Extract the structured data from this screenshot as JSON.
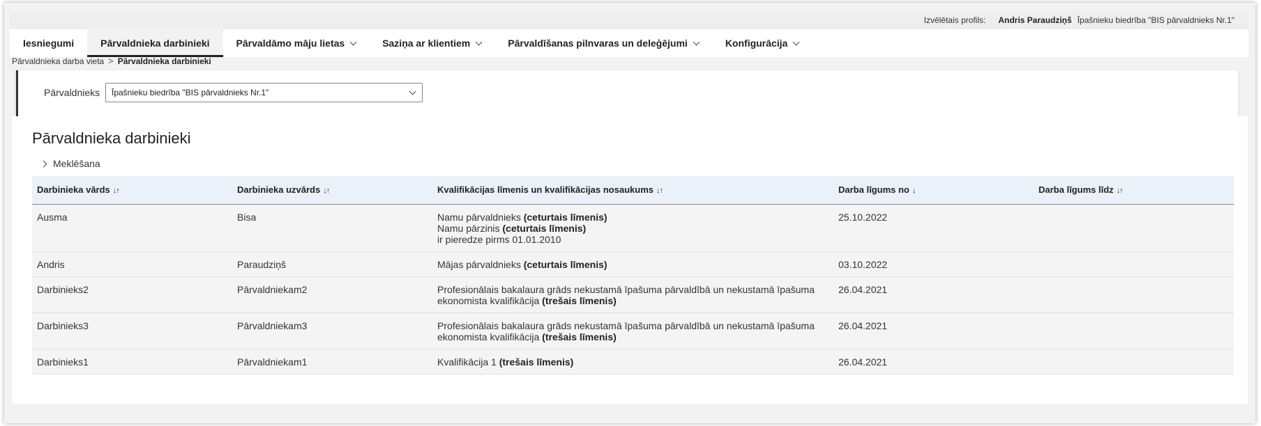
{
  "topbar": {
    "profile_label": "Izvēlētais profils:",
    "user_name": "Andris Paraudziņš",
    "organization": "Īpašnieku biedrība \"BIS pārvaldnieks Nr.1\""
  },
  "nav": {
    "items": [
      {
        "label": "Iesniegumi",
        "active": false,
        "dropdown": false
      },
      {
        "label": "Pārvaldnieka darbinieki",
        "active": true,
        "dropdown": false
      },
      {
        "label": "Pārvaldāmo māju lietas",
        "active": false,
        "dropdown": true
      },
      {
        "label": "Saziņa ar klientiem",
        "active": false,
        "dropdown": true
      },
      {
        "label": "Pārvaldīšanas pilnvaras un deleģējumi",
        "active": false,
        "dropdown": true
      },
      {
        "label": "Konfigurācija",
        "active": false,
        "dropdown": true
      }
    ]
  },
  "breadcrumb": {
    "parent": "Pārvaldnieka darba vieta",
    "separator": ">",
    "current": "Pārvaldnieka darbinieki"
  },
  "filter": {
    "label": "Pārvaldnieks",
    "selected_value": "Īpašnieku biedrība \"BIS pārvaldnieks Nr.1\""
  },
  "main": {
    "title": "Pārvaldnieka darbinieki",
    "search_toggle_label": "Meklēšana"
  },
  "table": {
    "headers": [
      {
        "label": "Darbinieka vārds",
        "sort": "↓↑"
      },
      {
        "label": "Darbinieka uzvārds",
        "sort": "↓↑"
      },
      {
        "label": "Kvalifikācijas līmenis un kvalifikācijas nosaukums",
        "sort": "↓↑"
      },
      {
        "label": "Darba līgums no",
        "sort": "↓"
      },
      {
        "label": "Darba līgums līdz",
        "sort": "↓↑"
      }
    ],
    "rows": [
      {
        "first_name": "Ausma",
        "last_name": "Bisa",
        "qualifications": [
          {
            "text": "Namu pārvaldnieks ",
            "level": "(ceturtais līmenis)"
          },
          {
            "text": "Namu pārzinis ",
            "level": "(ceturtais līmenis)"
          },
          {
            "text": "ir pieredze pirms 01.01.2010",
            "level": ""
          }
        ],
        "from": "25.10.2022",
        "to": ""
      },
      {
        "first_name": "Andris",
        "last_name": "Paraudziņš",
        "qualifications": [
          {
            "text": "Mājas pārvaldnieks ",
            "level": "(ceturtais līmenis)"
          }
        ],
        "from": "03.10.2022",
        "to": ""
      },
      {
        "first_name": "Darbinieks2",
        "last_name": "Pārvaldniekam2",
        "qualifications": [
          {
            "text": "Profesionālais bakalaura grāds nekustamā īpašuma pārvaldībā un nekustamā īpašuma ekonomista kvalifikācija ",
            "level": "(trešais līmenis)"
          }
        ],
        "from": "26.04.2021",
        "to": ""
      },
      {
        "first_name": "Darbinieks3",
        "last_name": "Pārvaldniekam3",
        "qualifications": [
          {
            "text": "Profesionālais bakalaura grāds nekustamā īpašuma pārvaldībā un nekustamā īpašuma ekonomista kvalifikācija ",
            "level": "(trešais līmenis)"
          }
        ],
        "from": "26.04.2021",
        "to": ""
      },
      {
        "first_name": "Darbinieks1",
        "last_name": "Pārvaldniekam1",
        "qualifications": [
          {
            "text": "Kvalifikācija 1 ",
            "level": "(trešais līmenis)"
          }
        ],
        "from": "26.04.2021",
        "to": ""
      }
    ]
  }
}
